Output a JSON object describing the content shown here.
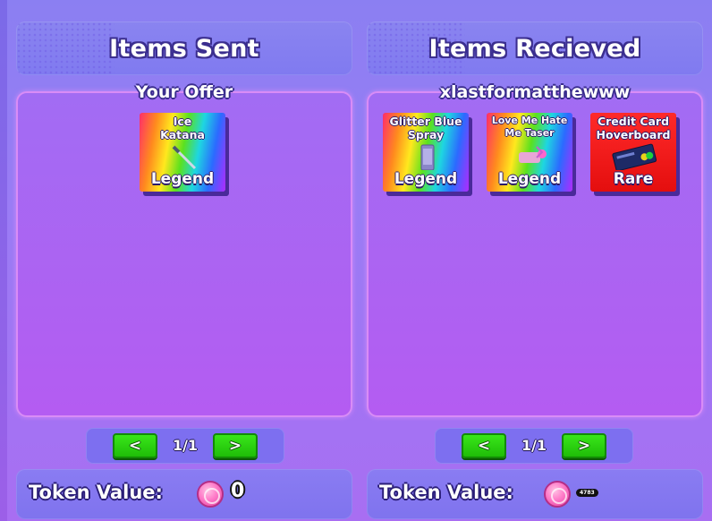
{
  "left": {
    "header": "Items Sent",
    "subtitle": "Your Offer",
    "items": [
      {
        "name": "Ice\nKatana",
        "rarity": "Legend",
        "icon": "katana-icon"
      }
    ],
    "pager": {
      "prev": "<",
      "page": "1/1",
      "next": ">"
    },
    "token_label": "Token Value:",
    "token_value": "0"
  },
  "right": {
    "header": "Items Recieved",
    "subtitle": "xlastformatthewww",
    "items": [
      {
        "name": "Glitter Blue Spray",
        "rarity": "Legend",
        "icon": "spray-can-icon"
      },
      {
        "name": "Love Me Hate Me Taser",
        "rarity": "Legend",
        "icon": "taser-icon"
      },
      {
        "name": "Credit Card Hoverboard",
        "rarity": "Rare",
        "icon": "credit-card-icon"
      }
    ],
    "pager": {
      "prev": "<",
      "page": "1/1",
      "next": ">"
    },
    "token_label": "Token Value:",
    "token_value": "4783"
  },
  "colors": {
    "legend": "rainbow",
    "rare": "#e81414",
    "button": "#2bd010",
    "panel": "#b060f2"
  }
}
